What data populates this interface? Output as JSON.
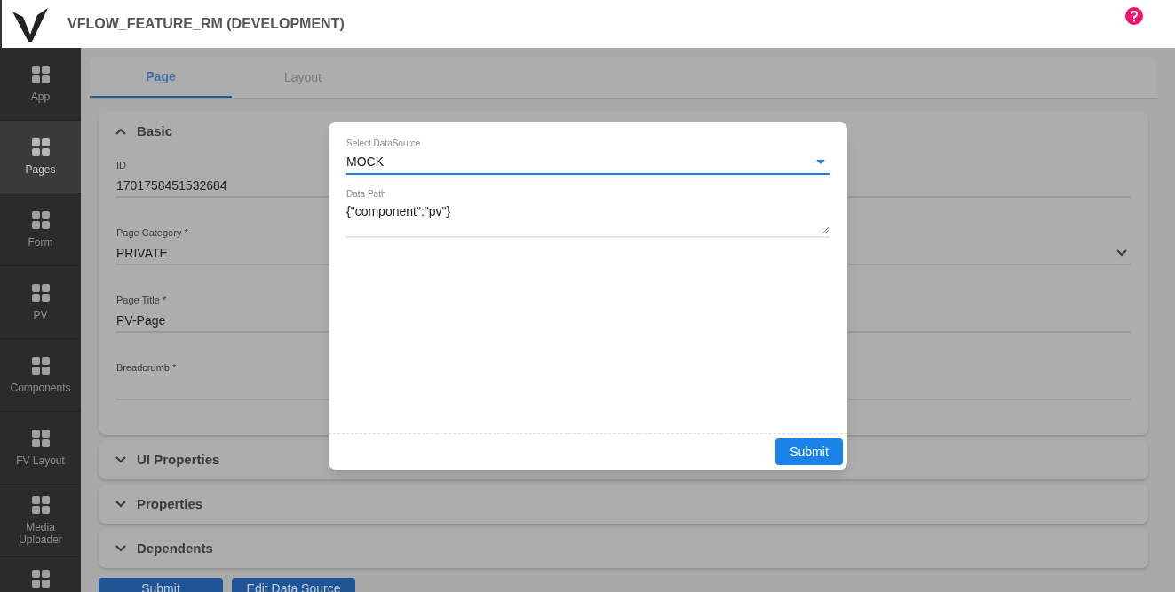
{
  "header": {
    "title": "VFLOW_FEATURE_RM (DEVELOPMENT)"
  },
  "sidebar": {
    "items": [
      {
        "label": "App",
        "selected": false
      },
      {
        "label": "Pages",
        "selected": true
      },
      {
        "label": "Form",
        "selected": false
      },
      {
        "label": "PV",
        "selected": false
      },
      {
        "label": "Components",
        "selected": false
      },
      {
        "label": "FV Layout",
        "selected": false
      },
      {
        "label": "Media Uploader",
        "selected": false
      }
    ]
  },
  "tabs": [
    {
      "label": "Page",
      "selected": true
    },
    {
      "label": "Layout",
      "selected": false
    }
  ],
  "sections": [
    {
      "title": "Basic",
      "expanded": true,
      "fields": [
        {
          "kind": "text",
          "label": "ID",
          "value": "1701758451532684"
        },
        {
          "kind": "select",
          "label": "Page Category *",
          "value": "PRIVATE"
        },
        {
          "kind": "text",
          "label": "Page Title *",
          "value": "PV-Page"
        },
        {
          "kind": "text",
          "label": "Breadcrumb *"
        }
      ]
    },
    {
      "title": "UI Properties",
      "expanded": false
    },
    {
      "title": "Properties",
      "expanded": false
    },
    {
      "title": "Dependents",
      "expanded": false
    }
  ],
  "buttons": [
    "Submit",
    "Edit Data Source"
  ],
  "dialog": {
    "datasource": {
      "label": "Select DataSource",
      "value": "MOCK"
    },
    "data_path": {
      "label": "Data Path",
      "value": "{\"component\":\"pv\"}"
    },
    "submit": "Submit"
  }
}
